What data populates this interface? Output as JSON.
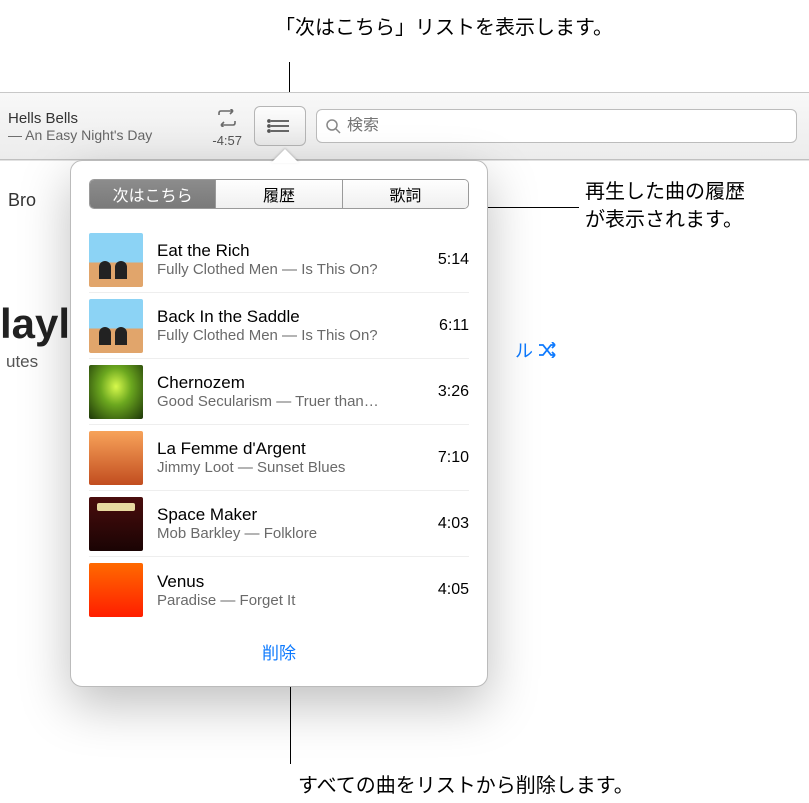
{
  "callouts": {
    "top": "「次はこちら」リストを表示します。",
    "right_line1": "再生した曲の履歴",
    "right_line2": "が表示されます。",
    "bottom": "すべての曲をリストから削除します。"
  },
  "toolbar": {
    "now_playing_title": "Hells Bells",
    "now_playing_sub": "— An Easy Night's Day",
    "time_remaining": "-4:57",
    "search_placeholder": "検索"
  },
  "background": {
    "browse_label": "Bro",
    "playlist_text": "layli",
    "utes_text": "utes",
    "shuffle_text": "ル"
  },
  "popover": {
    "tabs": {
      "up_next": "次はこちら",
      "history": "履歴",
      "lyrics": "歌詞"
    },
    "clear_label": "削除",
    "tracks": [
      {
        "title": "Eat the Rich",
        "sub": "Fully Clothed Men — Is This On?",
        "duration": "5:14"
      },
      {
        "title": "Back In the Saddle",
        "sub": "Fully Clothed Men — Is This On?",
        "duration": "6:11"
      },
      {
        "title": "Chernozem",
        "sub": "Good Secularism — Truer than…",
        "duration": "3:26"
      },
      {
        "title": "La Femme d'Argent",
        "sub": "Jimmy Loot — Sunset Blues",
        "duration": "7:10"
      },
      {
        "title": "Space Maker",
        "sub": "Mob Barkley — Folklore",
        "duration": "4:03"
      },
      {
        "title": "Venus",
        "sub": "Paradise — Forget It",
        "duration": "4:05"
      }
    ]
  }
}
